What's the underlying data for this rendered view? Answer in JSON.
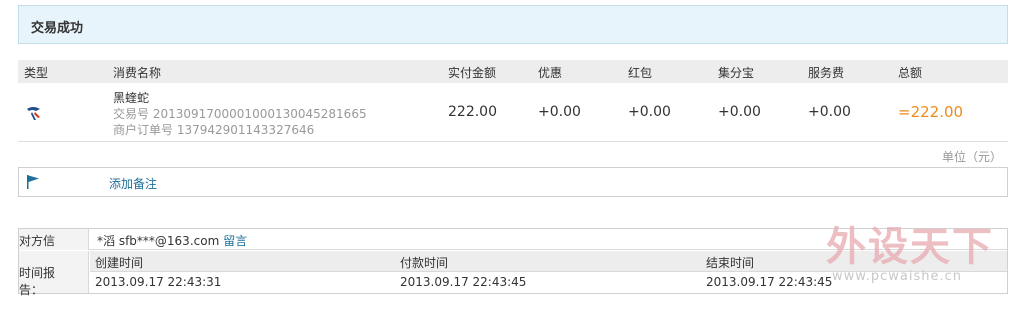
{
  "status": {
    "title": "交易成功"
  },
  "columns": {
    "type": "类型",
    "item_name": "消费名称",
    "paid": "实付金额",
    "discount": "优惠",
    "red_packet": "红包",
    "jifenbao": "集分宝",
    "service_fee": "服务费",
    "total": "总额"
  },
  "item": {
    "icon": "taobao-logo-icon",
    "name": "黑蝰蛇",
    "trade_no": "交易号 2013091700001000130045281665",
    "merchant_order_no": "商户订单号 137942901143327646",
    "paid": "222.00",
    "discount": "+0.00",
    "red_packet": "+0.00",
    "jifenbao": "+0.00",
    "service_fee": "+0.00",
    "total": "=222.00"
  },
  "unit_note": "单位（元）",
  "remark": {
    "icon": "flag-icon",
    "link": "添加备注"
  },
  "counterparty": {
    "label": "对方信息：",
    "name": "*滔  sfb***@163.com",
    "message_link": "留言"
  },
  "time_report": {
    "label": "时间报告：",
    "headers": [
      "创建时间",
      "付款时间",
      "结束时间"
    ],
    "values": [
      "2013.09.17 22:43:31",
      "2013.09.17 22:43:45",
      "2013.09.17 22:43:45"
    ]
  },
  "watermark": {
    "text": "外设天下",
    "url": "www.pcwaishe.cn"
  },
  "colors": {
    "accent_total": "#ec8c1b",
    "link": "#1d6f9c",
    "banner": "#e8f4fc"
  }
}
